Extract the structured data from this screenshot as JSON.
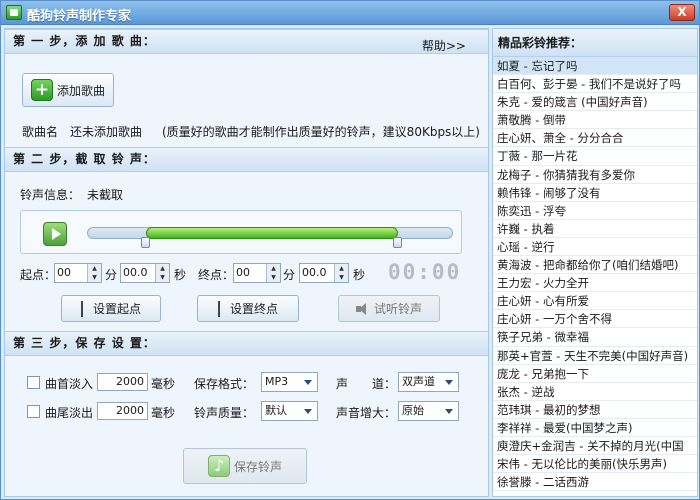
{
  "window": {
    "title": "酷狗铃声制作专家",
    "close_label": "X"
  },
  "step1": {
    "header": "第 一 步，添 加 歌 曲：",
    "help": "帮助>>",
    "add_song_label": "添加歌曲",
    "song_name_label": "歌曲名",
    "song_name_value": "还未添加歌曲",
    "hint": "(质量好的歌曲才能制作出质量好的铃声，建议80Kbps以上)"
  },
  "step2": {
    "header": "第 二 步，截 取 铃 声：",
    "info_label": "铃声信息：",
    "info_value": "未截取",
    "start_label": "起点：",
    "end_label": "终点：",
    "start_min": "00",
    "start_sec": "00.0",
    "end_min": "00",
    "end_sec": "00.0",
    "min_unit": "分",
    "sec_unit": "秒",
    "time_display": "00:00",
    "set_start": "设置起点",
    "set_end": "设置终点",
    "preview": "试听铃声",
    "selection": {
      "start_fraction": 0.16,
      "end_fraction": 0.85
    }
  },
  "step3": {
    "header": "第 三 步，保 存 设 置：",
    "fade_in_label": "曲首淡入",
    "fade_in_value": "2000",
    "fade_out_label": "曲尾淡出",
    "fade_out_value": "2000",
    "ms_unit": "毫秒",
    "format_label": "保存格式：",
    "format_value": "MP3",
    "channel_label": "声　　道：",
    "channel_value": "双声道",
    "quality_label": "铃声质量：",
    "quality_value": "默认",
    "gain_label": "声音增大：",
    "gain_value": "原始",
    "save_label": "保存铃声"
  },
  "sidebar": {
    "title": "精品彩铃推荐：",
    "items": [
      "如夏 - 忘记了吗",
      "白百何、彭于晏 - 我们不是说好了吗",
      "朱克 - 爱的箴言 (中国好声音)",
      "萧敬腾 - 倒带",
      "庄心妍、萧全 - 分分合合",
      "丁薇 - 那一片花",
      "龙梅子 - 你猜猜我有多爱你",
      "赖伟锋 - 闹够了没有",
      "陈奕迅 - 浮夸",
      "许巍 - 执着",
      "心瑶 - 逆行",
      "黄海波 - 把命都给你了(咱们结婚吧)",
      "王力宏 - 火力全开",
      "庄心妍 - 心有所爱",
      "庄心妍 - 一万个舍不得",
      "筷子兄弟 - 微幸福",
      "那英+官萱 - 天生不完美(中国好声音)",
      "庞龙 - 兄弟抱一下",
      "张杰 - 逆战",
      "范玮琪 - 最初的梦想",
      "李祥祥 - 最爱(中国梦之声)",
      "庾澄庆+金润吉 - 关不掉的月光(中国",
      "宋伟 - 无以伦比的美丽(快乐男声)",
      "徐誉滕 - 二话西游"
    ]
  },
  "colors": {
    "accent": "#5b97d6",
    "green": "#3fb51c"
  }
}
